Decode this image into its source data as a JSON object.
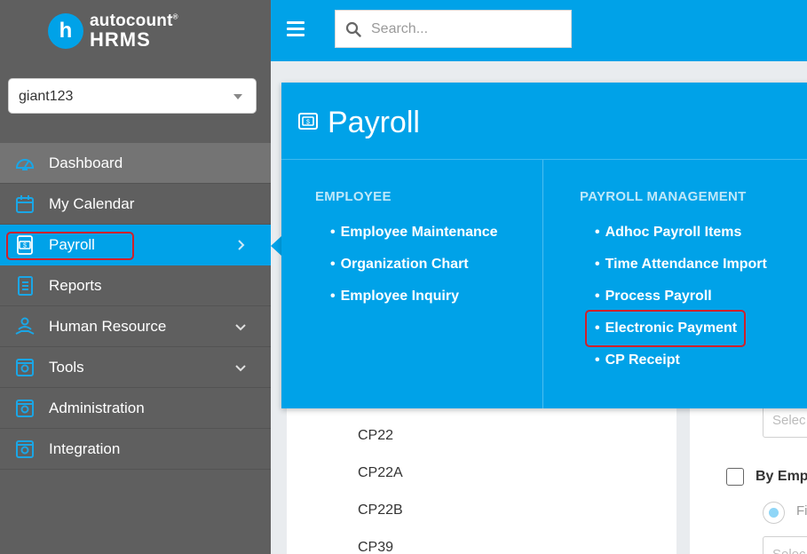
{
  "brand": {
    "name_top": "autocount",
    "trademark": "®",
    "name_bottom": "HRMS",
    "logo_letter": "h"
  },
  "company_select": {
    "value": "giant123"
  },
  "sidebar": {
    "items": [
      {
        "label": "Dashboard",
        "icon": "gauge-icon"
      },
      {
        "label": "My Calendar",
        "icon": "calendar-icon"
      },
      {
        "label": "Payroll",
        "icon": "payroll-icon"
      },
      {
        "label": "Reports",
        "icon": "reports-icon"
      },
      {
        "label": "Human Resource",
        "icon": "human-resource-icon"
      },
      {
        "label": "Tools",
        "icon": "tools-icon"
      },
      {
        "label": "Administration",
        "icon": "administration-icon"
      },
      {
        "label": "Integration",
        "icon": "integration-icon"
      }
    ]
  },
  "topbar": {
    "search_placeholder": "Search..."
  },
  "payroll_menu": {
    "title": "Payroll",
    "employee": {
      "heading": "EMPLOYEE",
      "links": [
        "Employee Maintenance",
        "Organization Chart",
        "Employee Inquiry"
      ]
    },
    "management": {
      "heading": "PAYROLL MANAGEMENT",
      "links": [
        "Adhoc Payroll Items",
        "Time Attendance Import",
        "Process Payroll",
        "Electronic Payment",
        "CP Receipt"
      ]
    }
  },
  "background": {
    "cp_links": [
      "CP22",
      "CP22A",
      "CP22B",
      "CP39"
    ],
    "select_placeholder_1": "Selec",
    "select_placeholder_2": "Selec",
    "by_employee": "By Empl",
    "radio_text": "Fi"
  },
  "colors": {
    "accent": "#00a2e8",
    "sidebar": "#5f5f5f",
    "highlight": "#d0202a"
  }
}
